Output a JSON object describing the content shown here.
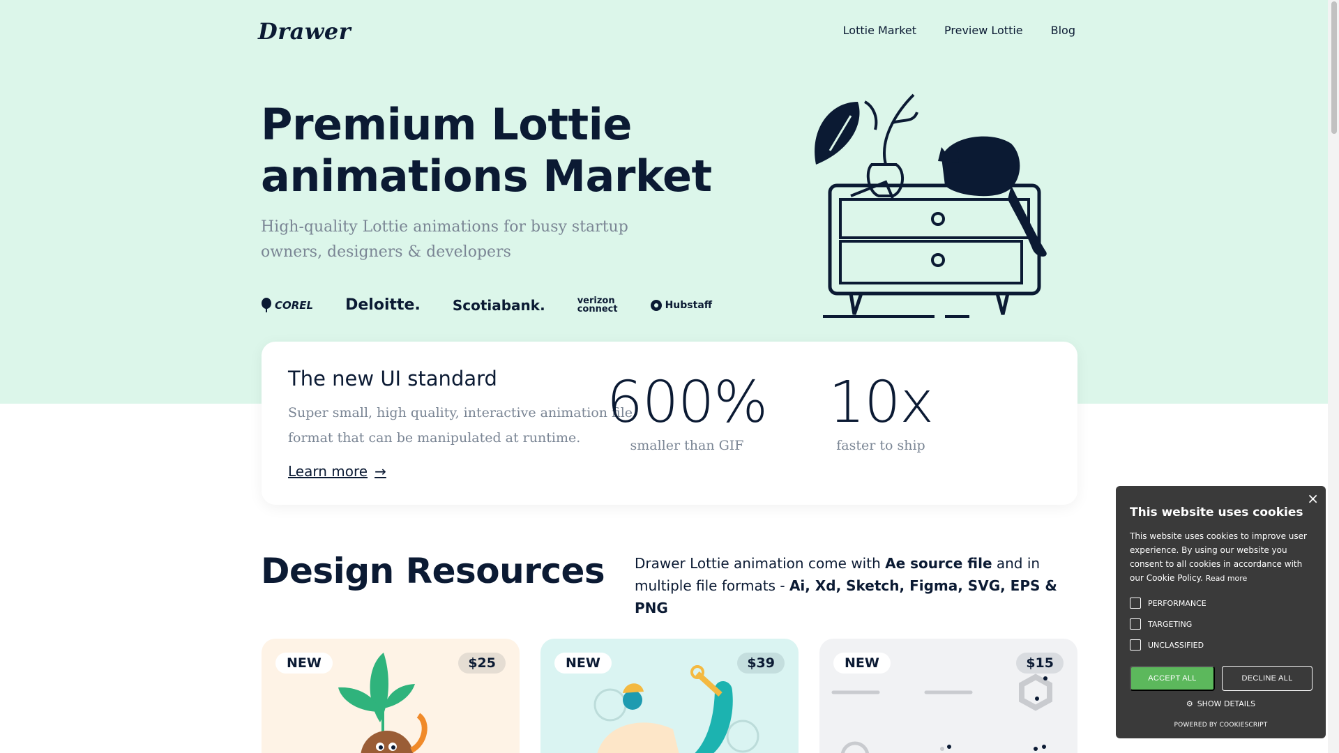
{
  "header": {
    "logo": "Drawer",
    "nav": [
      "Lottie Market",
      "Preview Lottie",
      "Blog"
    ]
  },
  "hero": {
    "title": "Premium Lottie animations Market",
    "subtitle": "High-quality Lottie animations for busy startup owners, designers & developers",
    "brands": [
      "COREL",
      "Deloitte.",
      "Scotiabank.",
      "verizon",
      "connect",
      "Hubstaff"
    ]
  },
  "feature": {
    "title": "The new UI standard",
    "text": "Super small, high quality, interactive animation file format that can be manipulated at runtime.",
    "link": "Learn more",
    "stats": [
      {
        "value": "600%",
        "label": "smaller than GIF"
      },
      {
        "value": "10x",
        "label": "faster to ship"
      }
    ]
  },
  "resources": {
    "title": "Design Resources",
    "desc_prefix": "Drawer Lottie animation come with ",
    "desc_bold1": "Ae source file",
    "desc_mid": " and in multiple file formats - ",
    "desc_bold2": "Ai, Xd, Sketch, Figma, SVG, EPS & PNG",
    "tiles": [
      {
        "badge": "NEW",
        "price": "$25"
      },
      {
        "badge": "NEW",
        "price": "$39"
      },
      {
        "badge": "NEW",
        "price": "$15"
      }
    ]
  },
  "cookie": {
    "close": "×",
    "title": "This website uses cookies",
    "text": "This website uses cookies to improve user experience. By using our website you consent to all cookies in accordance with our Cookie Policy.",
    "read_more": "Read more",
    "options": [
      "PERFORMANCE",
      "TARGETING",
      "UNCLASSIFIED"
    ],
    "accept": "ACCEPT ALL",
    "decline": "DECLINE ALL",
    "show_details": "SHOW DETAILS",
    "powered": "POWERED BY COOKIESCRIPT"
  },
  "colors": {
    "hero_bg": "#dcf6ea",
    "accent_green": "#5cb85c",
    "text_dark": "#0b1a33"
  }
}
